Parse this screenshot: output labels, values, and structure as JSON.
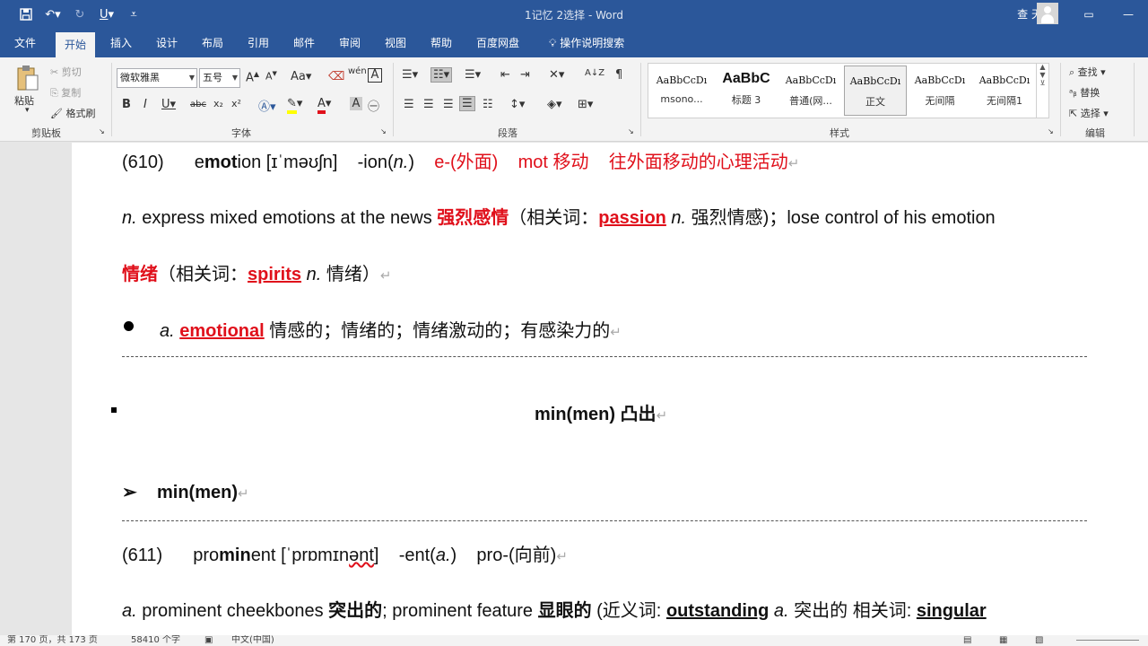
{
  "window": {
    "doc_title": "1记忆 2选择 - Word",
    "user_name": "查 天恩",
    "qat": [
      "save-icon",
      "undo-icon",
      "redo-icon",
      "underline-icon",
      "customize-icon"
    ]
  },
  "tabs": [
    "文件",
    "开始",
    "插入",
    "设计",
    "布局",
    "引用",
    "邮件",
    "审阅",
    "视图",
    "帮助",
    "百度网盘",
    "操作说明搜索"
  ],
  "active_tab": "开始",
  "ribbon": {
    "clipboard": {
      "paste": "粘贴",
      "cut": "剪切",
      "copy": "复制",
      "format_painter": "格式刷",
      "label": "剪贴板"
    },
    "font": {
      "name": "微软雅黑",
      "size": "五号",
      "label": "字体"
    },
    "paragraph": {
      "label": "段落"
    },
    "styles": {
      "label": "样式",
      "items": [
        {
          "sample": "AaBbCcDı",
          "name": "msono..."
        },
        {
          "sample": "AaBbC",
          "name": "标题 3"
        },
        {
          "sample": "AaBbCcDı",
          "name": "普通(网..."
        },
        {
          "sample": "AaBbCcDı",
          "name": "正文"
        },
        {
          "sample": "AaBbCcDı",
          "name": "无间隔"
        },
        {
          "sample": "AaBbCcDı",
          "name": "无间隔1"
        }
      ]
    },
    "editing": {
      "find": "查找",
      "replace": "替换",
      "select": "选择",
      "label": "编辑"
    }
  },
  "document": {
    "l1": {
      "num": "(610)",
      "w1": "e",
      "w2": "mot",
      "w3": "ion",
      "ipa": "[ɪˈməʊʃn]",
      "suffix": "-ion(",
      "suffix_it": "n.",
      "suffix_end": ")",
      "r1": "e-(外面)",
      "r2": "mot 移动",
      "r3": "往外面移动的心理活动"
    },
    "l2": {
      "pos": "n.",
      "t1": " express mixed emotions at the news ",
      "b1": "强烈感情",
      "t2": "（相关词：",
      "w": "passion",
      "pos2": " n.",
      "t3": " 强烈情感)；lose control of his emotion"
    },
    "l3": {
      "b1": "情绪",
      "t1": "（相关词：",
      "w": "spirits",
      "pos": " n.",
      "t2": " 情绪）"
    },
    "l4": {
      "pos": "a.",
      "w": "emotional",
      "t": " 情感的；情绪的；情绪激动的；有感染力的"
    },
    "l5": {
      "t": "min(men)  凸出"
    },
    "l6": {
      "t": "min(men)"
    },
    "l7": {
      "num": "(611)",
      "w1": "pro",
      "w2": "min",
      "w3": "ent",
      "ipa1": "[ˈprɒmɪn",
      "ipa2": "ənt",
      "ipa3": "]",
      "suffix": "-ent(",
      "suffix_it": "a.",
      "suffix_end": ")",
      "r1": "pro-(向前)"
    },
    "l8": {
      "pos": "a.",
      "t1": " prominent cheekbones ",
      "b1": "突出的",
      "t2": "; prominent feature ",
      "b2": "显眼的",
      "t3": " (近义词: ",
      "w1": "outstanding",
      "pos2": " a.",
      "t4": " 突出的  相关词: ",
      "w2": "singular"
    }
  },
  "status": {
    "page": "第 170 页，共 173 页",
    "words": "58410 个字",
    "lang": "中文(中国)"
  }
}
